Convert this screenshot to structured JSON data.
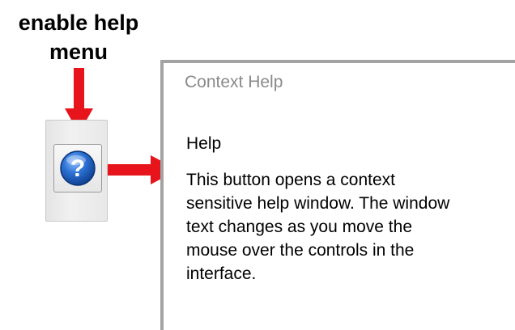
{
  "caption": {
    "line1": "enable help",
    "line2": "menu"
  },
  "help_button": {
    "icon": "question-mark-icon",
    "symbol": "?"
  },
  "context_help": {
    "window_title": "Context Help",
    "heading": "Help",
    "body": "This button opens a context sensitive help window.  The window text changes as you move the mouse over the controls in the interface."
  },
  "colors": {
    "arrow": "#e8141b",
    "icon_blue": "#1f5fb8",
    "panel_border": "#a3a3a3"
  }
}
